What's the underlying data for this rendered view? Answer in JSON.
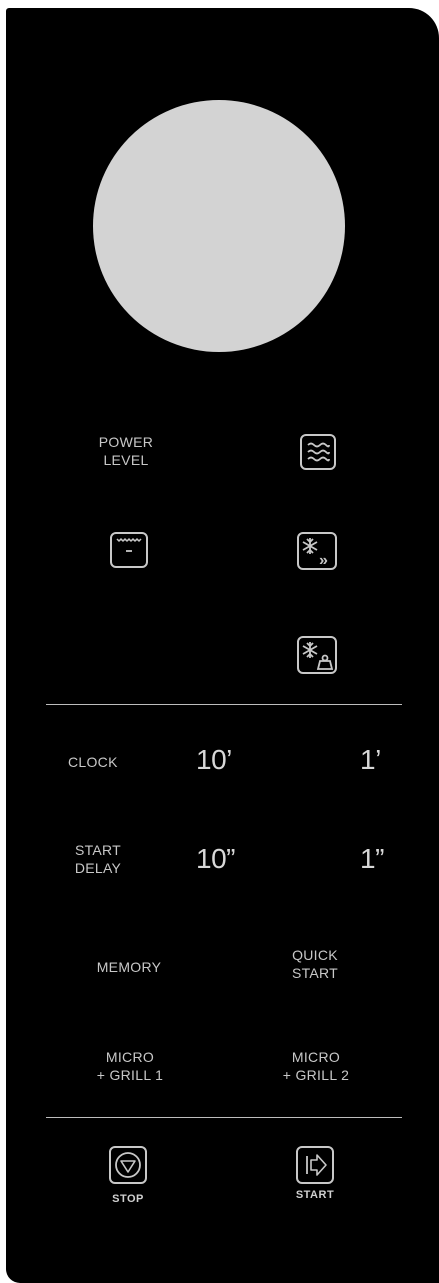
{
  "colors": {
    "panel": "#000000",
    "display": "#d3d3d3",
    "text": "#c8c8c8",
    "divider": "#bdbdbd"
  },
  "buttons": {
    "power_level": {
      "line1": "POWER",
      "line2": "LEVEL"
    },
    "clock": "CLOCK",
    "start_delay": {
      "line1": "START",
      "line2": "DELAY"
    },
    "ten_min": "10’",
    "one_min": "1’",
    "ten_sec": "10”",
    "one_sec": "1”",
    "memory": "MEMORY",
    "quick_start": {
      "line1": "QUICK",
      "line2": "START"
    },
    "micro_grill_1": {
      "line1": "MICRO",
      "line2": "+ GRILL 1"
    },
    "micro_grill_2": {
      "line1": "MICRO",
      "line2": "+ GRILL 2"
    },
    "stop": "STOP",
    "start": "START"
  },
  "icons": {
    "microwave": "microwave-waves-icon",
    "grill": "grill-icon",
    "quick_defrost": "quick-defrost-icon",
    "weight_defrost": "weight-defrost-icon",
    "stop": "stop-icon",
    "start": "start-icon"
  }
}
